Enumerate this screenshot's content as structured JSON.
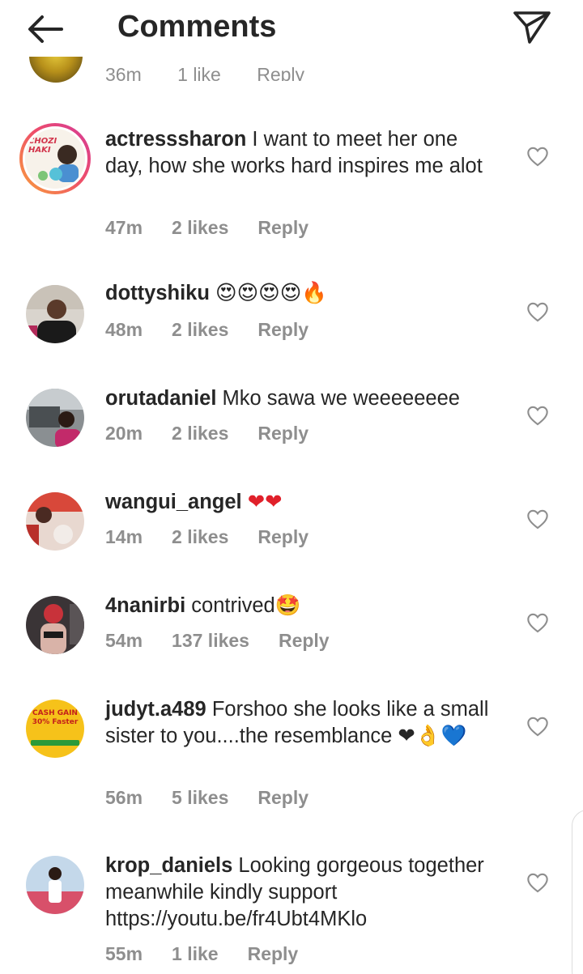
{
  "header": {
    "title": "Comments"
  },
  "partial_comment": {
    "time": "36m",
    "likes": "1 like",
    "reply": "Reply"
  },
  "comments": [
    {
      "username": "actresssharon",
      "text": " I want to meet her one day, how she works hard inspires me alot",
      "time": "47m",
      "likes": "2 likes",
      "reply": "Reply",
      "avatar_text": "CHOZI HAKI"
    },
    {
      "username": "dottyshiku",
      "text": " 😍😍😍😍🔥",
      "time": "48m",
      "likes": "2 likes",
      "reply": "Reply"
    },
    {
      "username": "orutadaniel",
      "text": " Mko sawa we weeeeeeee",
      "time": "20m",
      "likes": "2 likes",
      "reply": "Reply"
    },
    {
      "username": "wangui_angel",
      "text": " ❤❤",
      "time": "14m",
      "likes": "2 likes",
      "reply": "Reply"
    },
    {
      "username": "4nanirbi",
      "text": " contrived🤩",
      "time": "54m",
      "likes": "137 likes",
      "reply": "Reply"
    },
    {
      "username": "judyt.a489",
      "text": " Forshoo she looks like a small sister to you....the resemblance ❤👌💙",
      "time": "56m",
      "likes": "5 likes",
      "reply": "Reply",
      "avatar_text": "CASH GAIN 30% Faster"
    },
    {
      "username": "krop_daniels",
      "text": " Looking gorgeous together  meanwhile kindly support https://youtu.be/fr4Ubt4MKlo",
      "time": "55m",
      "likes": "1 like",
      "reply": "Reply"
    }
  ],
  "icons": {
    "back": "arrow-left-icon",
    "send": "paper-plane-icon",
    "like": "heart-outline-icon"
  },
  "colors": {
    "text": "#262626",
    "meta": "#8e8e8e",
    "story_ring": "#ee4d6a"
  }
}
